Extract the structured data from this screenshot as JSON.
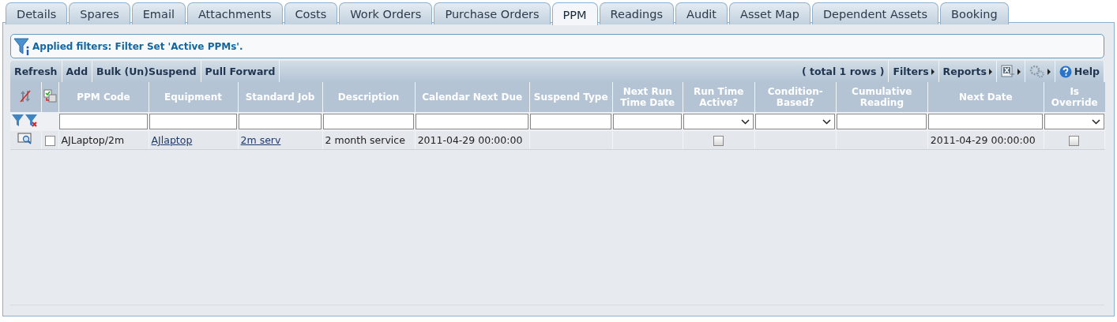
{
  "tabs": [
    {
      "label": "Details",
      "selected": false
    },
    {
      "label": "Spares",
      "selected": false
    },
    {
      "label": "Email",
      "selected": false
    },
    {
      "label": "Attachments",
      "selected": false
    },
    {
      "label": "Costs",
      "selected": false
    },
    {
      "label": "Work Orders",
      "selected": false
    },
    {
      "label": "Purchase Orders",
      "selected": false
    },
    {
      "label": "PPM",
      "selected": true
    },
    {
      "label": "Readings",
      "selected": false
    },
    {
      "label": "Audit",
      "selected": false
    },
    {
      "label": "Asset Map",
      "selected": false
    },
    {
      "label": "Dependent Assets",
      "selected": false
    },
    {
      "label": "Booking",
      "selected": false
    }
  ],
  "filter_banner": "Applied filters: Filter Set 'Active PPMs'.",
  "toolbar": {
    "left": [
      "Refresh",
      "Add",
      "Bulk (Un)Suspend",
      "Pull Forward"
    ],
    "total": "( total 1 rows )",
    "filters": "Filters",
    "reports": "Reports",
    "help": "Help"
  },
  "table": {
    "columns": [
      {
        "kind": "sort-icon"
      },
      {
        "kind": "select-icon"
      },
      {
        "label": "PPM Code",
        "kind": "input"
      },
      {
        "label": "Equipment",
        "kind": "input"
      },
      {
        "label": "Standard Job",
        "kind": "input"
      },
      {
        "label": "Description",
        "kind": "input"
      },
      {
        "label": "Calendar Next Due",
        "kind": "input"
      },
      {
        "label": "Suspend Type",
        "kind": "input"
      },
      {
        "label": "Next Run Time Date",
        "kind": "input"
      },
      {
        "label": "Run Time Active?",
        "kind": "select"
      },
      {
        "label": "Condition-Based?",
        "kind": "select"
      },
      {
        "label": "Cumulative Reading",
        "kind": "input"
      },
      {
        "label": "Next Date",
        "kind": "input"
      },
      {
        "label": "Is Override",
        "kind": "select"
      }
    ],
    "rows": [
      {
        "cells": [
          {
            "kind": "view-icon"
          },
          {
            "kind": "select-box",
            "checked": false
          },
          {
            "kind": "text",
            "text": "AJLaptop/2m"
          },
          {
            "kind": "link",
            "text": "AJlaptop"
          },
          {
            "kind": "link",
            "text": "2m serv"
          },
          {
            "kind": "text",
            "text": "2 month service"
          },
          {
            "kind": "text",
            "text": "2011-04-29 00:00:00"
          },
          {
            "kind": "empty"
          },
          {
            "kind": "empty"
          },
          {
            "kind": "checkbox",
            "checked": false
          },
          {
            "kind": "empty"
          },
          {
            "kind": "empty"
          },
          {
            "kind": "text",
            "text": "2011-04-29 00:00:00"
          },
          {
            "kind": "checkbox",
            "checked": false
          }
        ]
      }
    ]
  }
}
